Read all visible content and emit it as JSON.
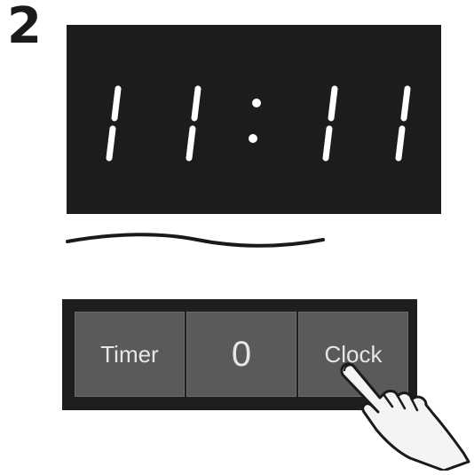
{
  "step": {
    "number": "2"
  },
  "display": {
    "time": "11:11",
    "digits": [
      "1",
      "1",
      "1",
      "1"
    ]
  },
  "buttons": {
    "timer_label": "Timer",
    "zero_label": "0",
    "clock_label": "Clock"
  },
  "icons": {
    "pointer": "pointing-hand-icon"
  },
  "colors": {
    "display_bg": "#1c1c1c",
    "segment": "#ffffff",
    "panel_bg": "#1e1e1e",
    "button_bg": "#5a5a5a",
    "button_text": "#e6e6e6"
  }
}
